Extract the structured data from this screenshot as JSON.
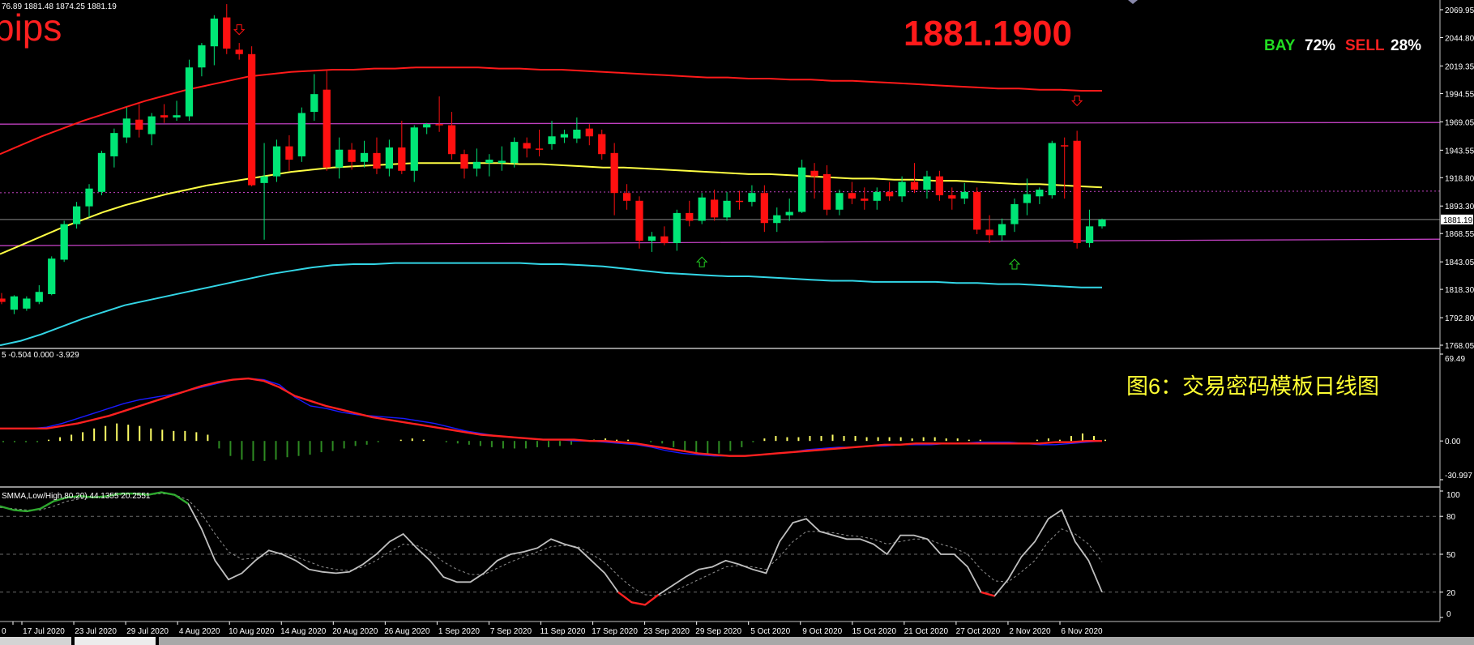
{
  "colors": {
    "bull": "#00e676",
    "bear": "#ff1010",
    "upper_env": "#ff1a1a",
    "lower_env": "#33d6e6",
    "slow_ma": "#ffff44",
    "level_line": "#c040c0",
    "macd_signal": "#ff2020",
    "macd_main": "#1a1aff",
    "hist_pos": "#ffff66",
    "hist_neg": "#2e8b22",
    "stoch_main": "#c0c0c0",
    "stoch_signal": "#909090",
    "stoch_ob": "#2ea82e",
    "stoch_os": "#ff2020",
    "separator": "#c0c0c0",
    "axis_text": "#ffffff"
  },
  "header": {
    "ohlc_info": "76.89 1881.48 1874.25 1881.19",
    "pips_label": "pips",
    "current_price": "1881.1900",
    "bay_label": "BAY",
    "bay_value": "72%",
    "sell_label": "SELL",
    "sell_value": "28%"
  },
  "caption": "图6：交易密码模板日线图",
  "price_axis": {
    "ticks": [
      "2069.95",
      "2044.80",
      "2019.35",
      "1994.55",
      "1969.05",
      "1943.55",
      "1918.80",
      "1893.30",
      "1868.55",
      "1843.05",
      "1818.30",
      "1792.80",
      "1768.05"
    ],
    "current_label": "1881.19"
  },
  "macd_panel": {
    "info": "5 -0.504 0.000 -3.929",
    "ticks": [
      "69.49",
      "0.00",
      "-30.997"
    ]
  },
  "stoch_panel": {
    "info": "SMMA,Low/High,80,20) 44.1355 20.2551",
    "ticks": [
      "100",
      "80",
      "50",
      "20",
      "0"
    ]
  },
  "dates": [
    "17 Jul 2020",
    "23 Jul 2020",
    "29 Jul 2020",
    "4 Aug 2020",
    "10 Aug 2020",
    "14 Aug 2020",
    "20 Aug 2020",
    "26 Aug 2020",
    "1 Sep 2020",
    "7 Sep 2020",
    "11 Sep 2020",
    "17 Sep 2020",
    "23 Sep 2020",
    "29 Sep 2020",
    "5 Oct 2020",
    "9 Oct 2020",
    "15 Oct 2020",
    "21 Oct 2020",
    "27 Oct 2020",
    "2 Nov 2020",
    "6 Nov 2020"
  ],
  "date_first_stub": "0",
  "chart_data": [
    {
      "type": "candlestick",
      "title": "",
      "ylim": [
        1768.05,
        2069.95
      ],
      "candles": [
        {
          "o": 1810,
          "h": 1815,
          "l": 1805,
          "c": 1807
        },
        {
          "o": 1800,
          "h": 1813,
          "l": 1796,
          "c": 1812
        },
        {
          "o": 1801,
          "h": 1812,
          "l": 1799,
          "c": 1810
        },
        {
          "o": 1807,
          "h": 1822,
          "l": 1805,
          "c": 1816
        },
        {
          "o": 1814,
          "h": 1848,
          "l": 1813,
          "c": 1846
        },
        {
          "o": 1845,
          "h": 1880,
          "l": 1843,
          "c": 1877
        },
        {
          "o": 1877,
          "h": 1897,
          "l": 1873,
          "c": 1893
        },
        {
          "o": 1893,
          "h": 1913,
          "l": 1883,
          "c": 1909
        },
        {
          "o": 1906,
          "h": 1943,
          "l": 1903,
          "c": 1941
        },
        {
          "o": 1938,
          "h": 1963,
          "l": 1928,
          "c": 1959
        },
        {
          "o": 1955,
          "h": 1982,
          "l": 1950,
          "c": 1972
        },
        {
          "o": 1971,
          "h": 1985,
          "l": 1955,
          "c": 1962
        },
        {
          "o": 1958,
          "h": 1977,
          "l": 1948,
          "c": 1974
        },
        {
          "o": 1975,
          "h": 1985,
          "l": 1968,
          "c": 1973
        },
        {
          "o": 1973,
          "h": 1988,
          "l": 1970,
          "c": 1975
        },
        {
          "o": 1974,
          "h": 2025,
          "l": 1970,
          "c": 2018
        },
        {
          "o": 2018,
          "h": 2040,
          "l": 2010,
          "c": 2038
        },
        {
          "o": 2037,
          "h": 2065,
          "l": 2020,
          "c": 2062
        },
        {
          "o": 2063,
          "h": 2075,
          "l": 2030,
          "c": 2035
        },
        {
          "o": 2034,
          "h": 2040,
          "l": 2025,
          "c": 2030
        },
        {
          "o": 2030,
          "h": 2037,
          "l": 1911,
          "c": 1912
        },
        {
          "o": 1914,
          "h": 1950,
          "l": 1863,
          "c": 1920
        },
        {
          "o": 1920,
          "h": 1953,
          "l": 1915,
          "c": 1947
        },
        {
          "o": 1947,
          "h": 1957,
          "l": 1925,
          "c": 1935
        },
        {
          "o": 1938,
          "h": 1982,
          "l": 1933,
          "c": 1977
        },
        {
          "o": 1978,
          "h": 2012,
          "l": 1970,
          "c": 1994
        },
        {
          "o": 1998,
          "h": 2015,
          "l": 1925,
          "c": 1928
        },
        {
          "o": 1928,
          "h": 1955,
          "l": 1918,
          "c": 1944
        },
        {
          "o": 1944,
          "h": 1950,
          "l": 1926,
          "c": 1933
        },
        {
          "o": 1933,
          "h": 1952,
          "l": 1928,
          "c": 1941
        },
        {
          "o": 1941,
          "h": 1955,
          "l": 1922,
          "c": 1927
        },
        {
          "o": 1927,
          "h": 1953,
          "l": 1920,
          "c": 1946
        },
        {
          "o": 1946,
          "h": 1970,
          "l": 1922,
          "c": 1925
        },
        {
          "o": 1925,
          "h": 1966,
          "l": 1915,
          "c": 1964
        },
        {
          "o": 1964,
          "h": 1968,
          "l": 1958,
          "c": 1967
        },
        {
          "o": 1967,
          "h": 1992,
          "l": 1960,
          "c": 1966
        },
        {
          "o": 1966,
          "h": 1978,
          "l": 1935,
          "c": 1940
        },
        {
          "o": 1940,
          "h": 1944,
          "l": 1918,
          "c": 1927
        },
        {
          "o": 1927,
          "h": 1945,
          "l": 1920,
          "c": 1933
        },
        {
          "o": 1932,
          "h": 1940,
          "l": 1920,
          "c": 1935
        },
        {
          "o": 1932,
          "h": 1947,
          "l": 1925,
          "c": 1934
        },
        {
          "o": 1932,
          "h": 1955,
          "l": 1928,
          "c": 1951
        },
        {
          "o": 1950,
          "h": 1955,
          "l": 1937,
          "c": 1945
        },
        {
          "o": 1945,
          "h": 1962,
          "l": 1938,
          "c": 1944
        },
        {
          "o": 1949,
          "h": 1970,
          "l": 1944,
          "c": 1956
        },
        {
          "o": 1955,
          "h": 1962,
          "l": 1950,
          "c": 1958
        },
        {
          "o": 1954,
          "h": 1973,
          "l": 1950,
          "c": 1962
        },
        {
          "o": 1963,
          "h": 1967,
          "l": 1948,
          "c": 1956
        },
        {
          "o": 1958,
          "h": 1962,
          "l": 1935,
          "c": 1940
        },
        {
          "o": 1941,
          "h": 1950,
          "l": 1885,
          "c": 1905
        },
        {
          "o": 1905,
          "h": 1913,
          "l": 1890,
          "c": 1898
        },
        {
          "o": 1898,
          "h": 1902,
          "l": 1855,
          "c": 1862
        },
        {
          "o": 1862,
          "h": 1870,
          "l": 1852,
          "c": 1866
        },
        {
          "o": 1866,
          "h": 1875,
          "l": 1858,
          "c": 1860
        },
        {
          "o": 1860,
          "h": 1890,
          "l": 1853,
          "c": 1887
        },
        {
          "o": 1887,
          "h": 1898,
          "l": 1875,
          "c": 1880
        },
        {
          "o": 1880,
          "h": 1905,
          "l": 1877,
          "c": 1901
        },
        {
          "o": 1899,
          "h": 1908,
          "l": 1880,
          "c": 1883
        },
        {
          "o": 1883,
          "h": 1906,
          "l": 1880,
          "c": 1898
        },
        {
          "o": 1898,
          "h": 1907,
          "l": 1890,
          "c": 1897
        },
        {
          "o": 1897,
          "h": 1912,
          "l": 1893,
          "c": 1905
        },
        {
          "o": 1905,
          "h": 1912,
          "l": 1870,
          "c": 1878
        },
        {
          "o": 1878,
          "h": 1892,
          "l": 1870,
          "c": 1885
        },
        {
          "o": 1885,
          "h": 1900,
          "l": 1880,
          "c": 1888
        },
        {
          "o": 1888,
          "h": 1935,
          "l": 1887,
          "c": 1928
        },
        {
          "o": 1925,
          "h": 1932,
          "l": 1900,
          "c": 1920
        },
        {
          "o": 1922,
          "h": 1930,
          "l": 1885,
          "c": 1890
        },
        {
          "o": 1890,
          "h": 1908,
          "l": 1885,
          "c": 1905
        },
        {
          "o": 1905,
          "h": 1915,
          "l": 1895,
          "c": 1900
        },
        {
          "o": 1900,
          "h": 1910,
          "l": 1890,
          "c": 1898
        },
        {
          "o": 1898,
          "h": 1910,
          "l": 1890,
          "c": 1906
        },
        {
          "o": 1906,
          "h": 1915,
          "l": 1898,
          "c": 1902
        },
        {
          "o": 1902,
          "h": 1920,
          "l": 1897,
          "c": 1915
        },
        {
          "o": 1915,
          "h": 1932,
          "l": 1905,
          "c": 1908
        },
        {
          "o": 1908,
          "h": 1925,
          "l": 1900,
          "c": 1920
        },
        {
          "o": 1920,
          "h": 1925,
          "l": 1898,
          "c": 1903
        },
        {
          "o": 1903,
          "h": 1910,
          "l": 1890,
          "c": 1900
        },
        {
          "o": 1900,
          "h": 1914,
          "l": 1895,
          "c": 1906
        },
        {
          "o": 1906,
          "h": 1910,
          "l": 1868,
          "c": 1872
        },
        {
          "o": 1872,
          "h": 1885,
          "l": 1860,
          "c": 1867
        },
        {
          "o": 1867,
          "h": 1882,
          "l": 1862,
          "c": 1877
        },
        {
          "o": 1877,
          "h": 1900,
          "l": 1870,
          "c": 1895
        },
        {
          "o": 1896,
          "h": 1918,
          "l": 1885,
          "c": 1904
        },
        {
          "o": 1902,
          "h": 1910,
          "l": 1895,
          "c": 1908
        },
        {
          "o": 1903,
          "h": 1952,
          "l": 1900,
          "c": 1950
        },
        {
          "o": 1948,
          "h": 1955,
          "l": 1900,
          "c": 1947
        },
        {
          "o": 1952,
          "h": 1961,
          "l": 1855,
          "c": 1860
        },
        {
          "o": 1860,
          "h": 1890,
          "l": 1856,
          "c": 1875
        },
        {
          "o": 1875,
          "h": 1882,
          "l": 1873,
          "c": 1881.19
        }
      ],
      "upper_envelope": [
        1940,
        1948,
        1956,
        1963,
        1970,
        1976,
        1982,
        1988,
        1993,
        1998,
        2002,
        2006,
        2010,
        2012,
        2014,
        2015,
        2016,
        2016,
        2017,
        2017,
        2018,
        2018,
        2018,
        2018,
        2017,
        2017,
        2016,
        2016,
        2015,
        2014,
        2013,
        2012,
        2011,
        2010,
        2009,
        2009,
        2008,
        2008,
        2007,
        2007,
        2006,
        2006,
        2005,
        2004,
        2003,
        2002,
        2001,
        2000,
        1999,
        1999,
        1998,
        1998,
        1997,
        1997
      ],
      "lower_envelope": [
        1768,
        1772,
        1778,
        1785,
        1792,
        1798,
        1804,
        1808,
        1812,
        1816,
        1820,
        1824,
        1828,
        1832,
        1835,
        1838,
        1840,
        1841,
        1841,
        1842,
        1842,
        1842,
        1842,
        1842,
        1842,
        1842,
        1841,
        1841,
        1840,
        1839,
        1837,
        1835,
        1833,
        1832,
        1831,
        1830,
        1830,
        1829,
        1828,
        1827,
        1826,
        1826,
        1825,
        1825,
        1825,
        1825,
        1824,
        1824,
        1823,
        1823,
        1822,
        1821,
        1820,
        1820
      ],
      "slow_ma": [
        1850,
        1858,
        1866,
        1874,
        1881,
        1888,
        1894,
        1899,
        1904,
        1908,
        1912,
        1915,
        1918,
        1921,
        1924,
        1926,
        1928,
        1929,
        1930,
        1931,
        1932,
        1932,
        1932,
        1932,
        1932,
        1931,
        1931,
        1930,
        1929,
        1928,
        1928,
        1927,
        1926,
        1925,
        1924,
        1923,
        1922,
        1922,
        1921,
        1920,
        1919,
        1918,
        1918,
        1917,
        1917,
        1916,
        1916,
        1915,
        1914,
        1913,
        1913,
        1912,
        1911,
        1910
      ],
      "resistance_level": 1967,
      "support_level": 1862,
      "dashed_level": 1906,
      "current_price": 1881.19,
      "sell_arrows": [
        {
          "index": 19,
          "price": 2052
        },
        {
          "index": 86,
          "price": 1988
        }
      ],
      "buy_arrows": [
        {
          "index": 56,
          "price": 1843
        },
        {
          "index": 81,
          "price": 1841
        }
      ]
    },
    {
      "type": "macd",
      "title": "",
      "ylim": [
        -30.997,
        69.49
      ],
      "histogram": [
        -1,
        -1,
        -1,
        -1,
        1,
        3,
        5,
        7,
        10,
        12,
        14,
        13,
        12,
        10,
        9,
        8,
        8,
        7,
        5,
        -6,
        -12,
        -15,
        -16,
        -16,
        -15,
        -13,
        -12,
        -11,
        -9,
        -8,
        -6,
        -4,
        -3,
        -1,
        0,
        1,
        2,
        1,
        0,
        -1,
        -2,
        -3,
        -4,
        -5,
        -6,
        -6,
        -6,
        -5,
        -5,
        -4,
        -3,
        0,
        1,
        2,
        1,
        1,
        0,
        -1,
        -2,
        -5,
        -8,
        -11,
        -11,
        -10,
        -8,
        -5,
        -1,
        2,
        4,
        3,
        3,
        4,
        4,
        5,
        4,
        4,
        3,
        3,
        3,
        3,
        2,
        3,
        3,
        2,
        2,
        1,
        1,
        0,
        0,
        0,
        0,
        1,
        2,
        1,
        4,
        6,
        4,
        1
      ],
      "macd_line": [
        10,
        10,
        10,
        11,
        14,
        18,
        22,
        26,
        30,
        33,
        35,
        37,
        40,
        43,
        46,
        49,
        50,
        49,
        45,
        35,
        28,
        26,
        23,
        21,
        20,
        19,
        18,
        16,
        14,
        11,
        8,
        6,
        4,
        3,
        2,
        1,
        1,
        0,
        0,
        -1,
        -2,
        -3,
        -5,
        -8,
        -10,
        -11,
        -12,
        -12,
        -12,
        -11,
        -10,
        -9,
        -7,
        -6,
        -5,
        -5,
        -4,
        -4,
        -3,
        -3,
        -3,
        -2,
        -2,
        -1,
        -1,
        -1,
        -2,
        -3,
        -3,
        -2,
        -1,
        0
      ],
      "signal_line": [
        10,
        10,
        10,
        10,
        12,
        14,
        17,
        20,
        24,
        28,
        32,
        36,
        40,
        44,
        47,
        49,
        50,
        48,
        43,
        36,
        32,
        28,
        25,
        22,
        19,
        17,
        15,
        13,
        11,
        9,
        7,
        5,
        4,
        3,
        2,
        1,
        1,
        1,
        0,
        0,
        -1,
        -2,
        -4,
        -6,
        -8,
        -10,
        -11,
        -12,
        -12,
        -11,
        -10,
        -9,
        -8,
        -7,
        -6,
        -5,
        -4,
        -3,
        -3,
        -2,
        -2,
        -2,
        -2,
        -2,
        -2,
        -2,
        -2,
        -2,
        -1,
        -1,
        0,
        0
      ]
    },
    {
      "type": "stochastic",
      "title": "",
      "ylim": [
        0,
        100
      ],
      "levels": [
        80,
        50,
        20
      ],
      "main_line": [
        88,
        85,
        84,
        86,
        92,
        95,
        96,
        95,
        96,
        98,
        98,
        97,
        99,
        97,
        90,
        70,
        45,
        30,
        35,
        45,
        53,
        50,
        45,
        38,
        36,
        35,
        36,
        42,
        50,
        60,
        66,
        55,
        45,
        32,
        28,
        28,
        35,
        45,
        50,
        52,
        55,
        62,
        58,
        55,
        45,
        35,
        20,
        12,
        10,
        18,
        25,
        32,
        38,
        40,
        45,
        42,
        38,
        35,
        60,
        75,
        78,
        68,
        65,
        62,
        62,
        58,
        50,
        65,
        65,
        62,
        50,
        50,
        40,
        20,
        17,
        30,
        48,
        60,
        78,
        85,
        60,
        45,
        20
      ],
      "signal_line": [
        87,
        86,
        85,
        85,
        88,
        92,
        94,
        95,
        96,
        97,
        98,
        97,
        98,
        97,
        93,
        82,
        66,
        52,
        46,
        47,
        50,
        51,
        48,
        44,
        40,
        38,
        37,
        40,
        45,
        52,
        58,
        57,
        52,
        44,
        38,
        34,
        34,
        39,
        44,
        48,
        52,
        56,
        57,
        56,
        50,
        44,
        33,
        24,
        18,
        17,
        20,
        25,
        30,
        35,
        40,
        41,
        40,
        38,
        48,
        60,
        68,
        68,
        67,
        65,
        64,
        62,
        58,
        60,
        62,
        62,
        58,
        55,
        50,
        38,
        29,
        28,
        36,
        45,
        60,
        70,
        66,
        58,
        44
      ]
    }
  ]
}
